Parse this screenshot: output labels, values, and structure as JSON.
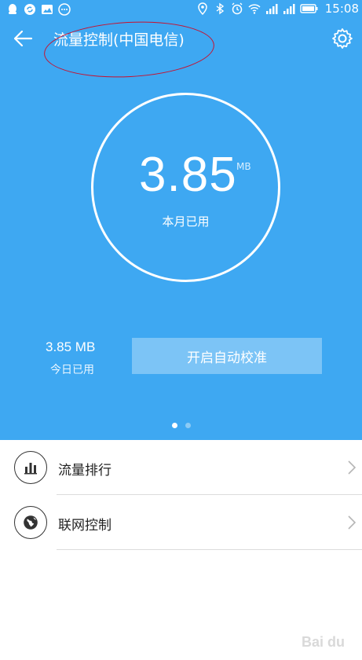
{
  "status_bar": {
    "time": "15:08",
    "left_icons": [
      "qq-icon",
      "sync-icon",
      "image-icon",
      "more-icon"
    ],
    "right_icons": [
      "location-icon",
      "bluetooth-icon",
      "alarm-icon",
      "wifi-icon",
      "signal-icon",
      "signal-icon",
      "battery-icon"
    ]
  },
  "header": {
    "title": "流量控制(中国电信)",
    "back_icon": "back-arrow-icon",
    "settings_icon": "gear-icon"
  },
  "usage": {
    "monthly_value": "3.85",
    "monthly_unit": "MB",
    "monthly_label": "本月已用",
    "today_value": "3.85 MB",
    "today_label": "今日已用"
  },
  "calibrate_button": "开启自动校准",
  "pager": {
    "total": 2,
    "active": 1
  },
  "menu": [
    {
      "label": "流量排行",
      "icon": "bar-chart-icon"
    },
    {
      "label": "联网控制",
      "icon": "globe-icon"
    }
  ],
  "colors": {
    "header_bg": "#3ea8f2",
    "button_bg": "#7cc4f6",
    "annotation": "#c8102e"
  }
}
